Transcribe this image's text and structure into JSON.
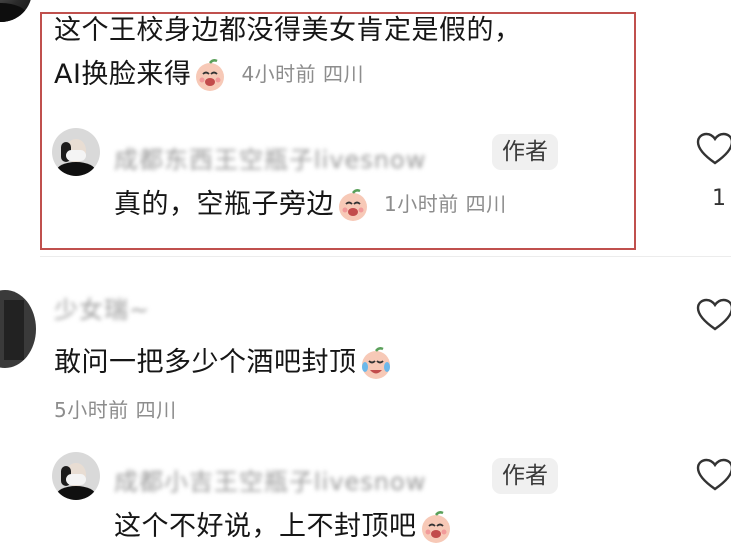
{
  "comments": [
    {
      "text_line1": "这个王校身边都没得美女肯定是假的，",
      "text_line2": "AI换脸来得",
      "emoji": "laughing-face-emoji",
      "meta": "4小时前  四川",
      "reply": {
        "username": "成都东西王空瓶子livesnow",
        "badge": "作者",
        "text": "真的，空瓶子旁边",
        "emoji": "laughing-face-emoji",
        "meta": "1小时前  四川"
      },
      "like_count": "1"
    },
    {
      "username": "少女瑞~",
      "text": "敢问一把多少个酒吧封顶",
      "emoji": "crying-laughing-emoji",
      "meta": "5小时前  四川",
      "reply": {
        "username": "成都小吉王空瓶子livesnow",
        "badge": "作者",
        "text": "这个不好说，上不封顶吧",
        "emoji": "laughing-face-emoji"
      }
    }
  ],
  "colors": {
    "highlight_border": "#c0504d",
    "meta_text": "#8d8d8d",
    "badge_bg": "#f0f0f0"
  }
}
